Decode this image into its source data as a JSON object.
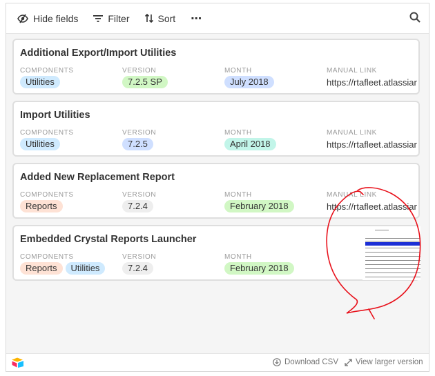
{
  "toolbar": {
    "hide_fields": "Hide fields",
    "filter": "Filter",
    "sort": "Sort",
    "more": "⋯"
  },
  "field_labels": {
    "components": "COMPONENTS",
    "version": "VERSION",
    "month": "MONTH",
    "manual_link": "MANUAL LINK"
  },
  "records": [
    {
      "title": "Additional Export/Import Utilities",
      "components": [
        {
          "label": "Utilities",
          "color": "#cfeafe"
        }
      ],
      "version": {
        "label": "7.2.5 SP",
        "color": "#d1f7c4"
      },
      "month": {
        "label": "July 2018",
        "color": "#cfdfff"
      },
      "link": "https://rtafleet.atlassian.net"
    },
    {
      "title": "Import Utilities",
      "components": [
        {
          "label": "Utilities",
          "color": "#cfeafe"
        }
      ],
      "version": {
        "label": "7.2.5",
        "color": "#cfdfff"
      },
      "month": {
        "label": "April 2018",
        "color": "#c2f5e9"
      },
      "link": "https://rtafleet.atlassian.net"
    },
    {
      "title": "Added New Replacement Report",
      "components": [
        {
          "label": "Reports",
          "color": "#fee2d5"
        }
      ],
      "version": {
        "label": "7.2.4",
        "color": "#eeeeee"
      },
      "month": {
        "label": "February 2018",
        "color": "#d1f7c4"
      },
      "link": "https://rtafleet.atlassian.net"
    },
    {
      "title": "Embedded Crystal Reports Launcher",
      "components": [
        {
          "label": "Reports",
          "color": "#fee2d5"
        },
        {
          "label": "Utilities",
          "color": "#cfeafe"
        }
      ],
      "version": {
        "label": "7.2.4",
        "color": "#eeeeee"
      },
      "month": {
        "label": "February 2018",
        "color": "#d1f7c4"
      },
      "link": ""
    }
  ],
  "footer": {
    "download_csv": "Download CSV",
    "view_larger": "View larger version"
  },
  "colors": {
    "annotation": "#e8101a",
    "thumbnail_selection": "#1b2fd6"
  }
}
